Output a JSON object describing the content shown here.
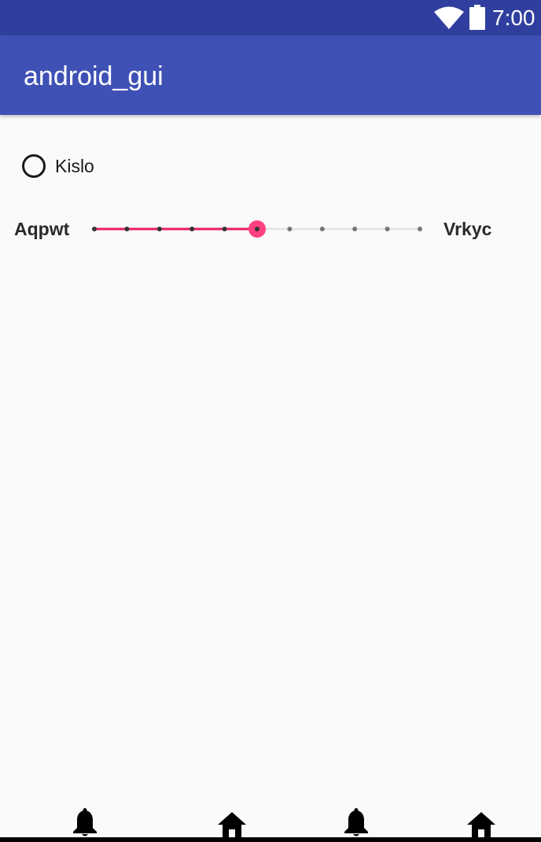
{
  "status_bar": {
    "time": "7:00",
    "icons": [
      "wifi-icon",
      "battery-icon"
    ]
  },
  "app_bar": {
    "title": "android_gui"
  },
  "radio": {
    "label": "Kislo",
    "checked": false
  },
  "slider": {
    "min_label": "Aqpwt",
    "max_label": "Vrkyc",
    "steps": 10,
    "value": 5,
    "colors": {
      "active": "#e91e63",
      "thumb": "#ff4081",
      "inactive_track": "#e6e6e6",
      "tick_active": "#333333",
      "tick_inactive": "#777777"
    }
  },
  "bottom_nav": {
    "items": [
      {
        "icon": "bell-icon"
      },
      {
        "icon": "home-icon"
      },
      {
        "icon": "bell-icon"
      },
      {
        "icon": "home-icon"
      }
    ]
  },
  "colors": {
    "status_bar": "#303f9f",
    "app_bar": "#3f51b5",
    "background": "#fafafa"
  }
}
